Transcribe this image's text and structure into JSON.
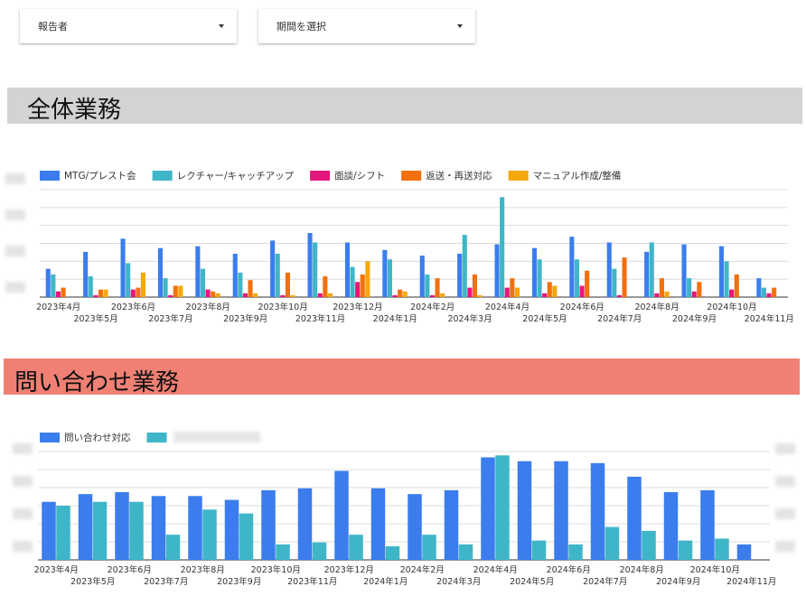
{
  "filters": {
    "reporter_label": "報告者",
    "period_label": "期間を選択"
  },
  "sections": {
    "overall_title": "全体業務",
    "inquiry_title": "問い合わせ業務"
  },
  "colors": {
    "overall_bar_bg": "#d3d3d3",
    "inquiry_bar_bg": "#f08074",
    "blue": "#3b7ded",
    "teal": "#3fb6c8",
    "magenta": "#e2177d",
    "orange": "#f2700e",
    "yellow": "#f5a70b"
  },
  "chart_data": [
    {
      "type": "bar",
      "categories": [
        "2023年4月",
        "2023年5月",
        "2023年6月",
        "2023年7月",
        "2023年8月",
        "2023年9月",
        "2023年10月",
        "2023年11月",
        "2023年12月",
        "2024年1月",
        "2024年2月",
        "2024年3月",
        "2024年4月",
        "2024年5月",
        "2024年6月",
        "2024年7月",
        "2024年8月",
        "2024年9月",
        "2024年10月",
        "2024年11月"
      ],
      "series": [
        {
          "name": "MTG/プレスト会",
          "color": "#3b7ded",
          "values": [
            15,
            24,
            31,
            26,
            27,
            23,
            30,
            34,
            29,
            25,
            22,
            23,
            28,
            26,
            32,
            29,
            24,
            28,
            27,
            10
          ]
        },
        {
          "name": "レクチャー/キャッチアップ",
          "color": "#3fb6c8",
          "values": [
            12,
            11,
            18,
            10,
            15,
            13,
            23,
            29,
            16,
            20,
            12,
            33,
            53,
            20,
            20,
            15,
            29,
            10,
            19,
            5
          ]
        },
        {
          "name": "面談/シフト",
          "color": "#e2177d",
          "values": [
            3,
            1,
            4,
            1,
            4,
            2,
            1,
            2,
            8,
            1,
            1,
            5,
            5,
            2,
            6,
            1,
            2,
            3,
            4,
            2
          ]
        },
        {
          "name": "返送・再送対応",
          "color": "#f2700e",
          "values": [
            5,
            4,
            5,
            6,
            3,
            9,
            13,
            11,
            12,
            4,
            10,
            12,
            10,
            8,
            14,
            21,
            10,
            8,
            12,
            5
          ]
        },
        {
          "name": "マニュアル作成/整備",
          "color": "#f5a70b",
          "values": [
            0,
            4,
            13,
            6,
            2,
            2,
            1,
            2,
            19,
            3,
            2,
            1,
            5,
            6,
            0,
            0,
            3,
            0,
            0,
            0
          ]
        }
      ],
      "ylim": [
        0,
        57
      ],
      "grid": true,
      "legend": "top-left"
    },
    {
      "type": "bar",
      "categories": [
        "2023年4月",
        "2023年5月",
        "2023年6月",
        "2023年7月",
        "2023年8月",
        "2023年9月",
        "2023年10月",
        "2023年11月",
        "2023年12月",
        "2024年1月",
        "2024年2月",
        "2024年3月",
        "2024年4月",
        "2024年5月",
        "2024年6月",
        "2024年7月",
        "2024年8月",
        "2024年9月",
        "2024年10月",
        "2024年11月"
      ],
      "series": [
        {
          "name": "問い合わせ対応",
          "color": "#3b7ded",
          "values": [
            30,
            34,
            35,
            33,
            33,
            31,
            36,
            37,
            46,
            37,
            34,
            36,
            53,
            51,
            51,
            50,
            43,
            35,
            36,
            8
          ]
        },
        {
          "color": "#3fb6c8",
          "values": [
            28,
            30,
            30,
            13,
            26,
            24,
            8,
            9,
            13,
            7,
            13,
            8,
            54,
            10,
            8,
            17,
            15,
            10,
            11,
            0
          ]
        }
      ],
      "ylim": [
        0,
        56
      ],
      "grid": true,
      "legend": "top-left"
    }
  ]
}
